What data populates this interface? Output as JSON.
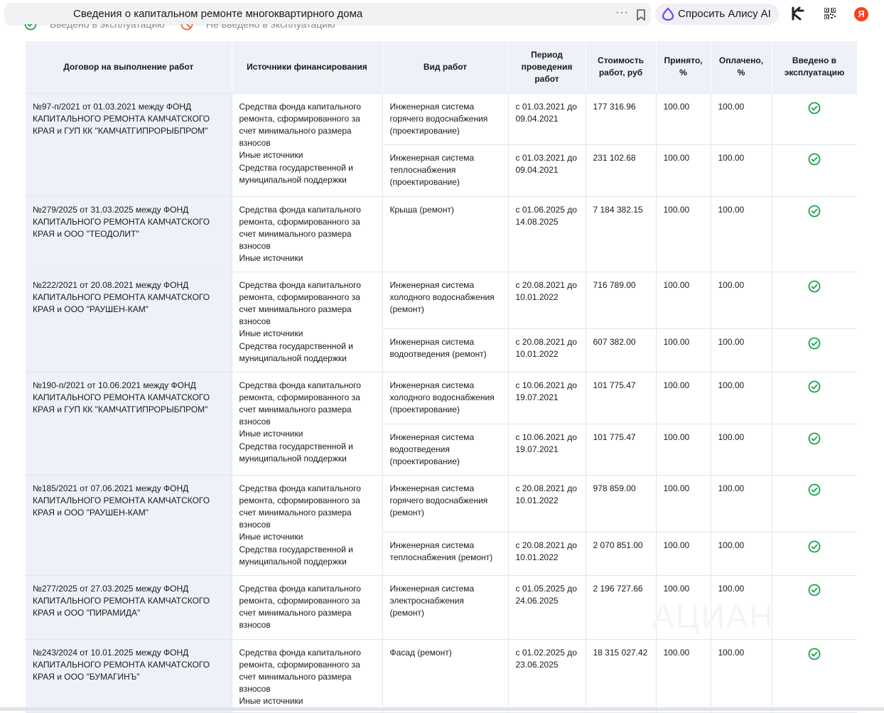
{
  "browser": {
    "page_title": "Сведения о капитальном ремонте многоквартирного дома",
    "menu_dots": "···",
    "alice_label": "Спросить Алису AI",
    "yandex_letter": "Я"
  },
  "legend": {
    "in_operation": "Введено в эксплуатацию",
    "not_in_operation": "Не введено в эксплуатацию"
  },
  "watermark": "АЦИАН",
  "table": {
    "headers": [
      "Договор на выполнение работ",
      "Источники финансирования",
      "Вид работ",
      "Период проведения работ",
      "Стоимость работ, руб",
      "Принято, %",
      "Оплачено, %",
      "Введено в эксплуатацию"
    ],
    "contracts": [
      {
        "contract": "№97-п/2021 от 01.03.2021 между ФОНД КАПИТАЛЬНОГО РЕМОНТА КАМЧАТСКОГО КРАЯ и ГУП КК \"КАМЧАТГИПРОРЫБПРОМ\"",
        "sources": [
          "Средства фонда капитального ремонта, сформированного за счет минимального размера взносов",
          "Иные источники",
          "Средства государственной и муниципальной поддержки"
        ],
        "works": [
          {
            "type": "Инженерная система горячего водоснабжения (проектирование)",
            "period": "с 01.03.2021 до 09.04.2021",
            "cost": "177 316.96",
            "accepted": "100.00",
            "paid": "100.00",
            "in_operation": true
          },
          {
            "type": "Инженерная система теплоснабжения (проектирование)",
            "period": "с 01.03.2021 до 09.04.2021",
            "cost": "231 102.68",
            "accepted": "100.00",
            "paid": "100.00",
            "in_operation": true
          }
        ]
      },
      {
        "contract": "№279/2025 от 31.03.2025 между ФОНД КАПИТАЛЬНОГО РЕМОНТА КАМЧАТСКОГО КРАЯ и ООО \"ТЕОДОЛИТ\"",
        "sources": [
          "Средства фонда капитального ремонта, сформированного за счет минимального размера взносов",
          "Иные источники"
        ],
        "works": [
          {
            "type": "Крыша (ремонт)",
            "period": "с 01.06.2025 до 14.08.2025",
            "cost": "7 184 382.15",
            "accepted": "100.00",
            "paid": "100.00",
            "in_operation": true
          }
        ]
      },
      {
        "contract": "№222/2021 от 20.08.2021 между ФОНД КАПИТАЛЬНОГО РЕМОНТА КАМЧАТСКОГО КРАЯ и ООО \"РАУШЕН-КАМ\"",
        "sources": [
          "Средства фонда капитального ремонта, сформированного за счет минимального размера взносов",
          "Иные источники",
          "Средства государственной и муниципальной поддержки"
        ],
        "works": [
          {
            "type": "Инженерная система холодного водоснабжения (ремонт)",
            "period": "с 20.08.2021 до 10.01.2022",
            "cost": "716 789.00",
            "accepted": "100.00",
            "paid": "100.00",
            "in_operation": true
          },
          {
            "type": "Инженерная система водоотведения (ремонт)",
            "period": "с 20.08.2021 до 10.01.2022",
            "cost": "607 382.00",
            "accepted": "100.00",
            "paid": "100.00",
            "in_operation": true
          }
        ]
      },
      {
        "contract": "№190-п/2021 от 10.06.2021 между ФОНД КАПИТАЛЬНОГО РЕМОНТА КАМЧАТСКОГО КРАЯ и ГУП КК \"КАМЧАТГИПРОРЫБПРОМ\"",
        "sources": [
          "Средства фонда капитального ремонта, сформированного за счет минимального размера взносов",
          "Иные источники",
          "Средства государственной и муниципальной поддержки"
        ],
        "works": [
          {
            "type": "Инженерная система холодного водоснабжения (проектирование)",
            "period": "с 10.06.2021 до 19.07.2021",
            "cost": "101 775.47",
            "accepted": "100.00",
            "paid": "100.00",
            "in_operation": true
          },
          {
            "type": "Инженерная система водоотведения (проектирование)",
            "period": "с 10.06.2021 до 19.07.2021",
            "cost": "101 775.47",
            "accepted": "100.00",
            "paid": "100.00",
            "in_operation": true
          }
        ]
      },
      {
        "contract": "№185/2021 от 07.06.2021 между ФОНД КАПИТАЛЬНОГО РЕМОНТА КАМЧАТСКОГО КРАЯ и ООО \"РАУШЕН-КАМ\"",
        "sources": [
          "Средства фонда капитального ремонта, сформированного за счет минимального размера взносов",
          "Иные источники",
          "Средства государственной и муниципальной поддержки"
        ],
        "works": [
          {
            "type": "Инженерная система горячего водоснабжения (ремонт)",
            "period": "с 20.08.2021 до 10.01.2022",
            "cost": "978 859.00",
            "accepted": "100.00",
            "paid": "100.00",
            "in_operation": true
          },
          {
            "type": "Инженерная система теплоснабжения (ремонт)",
            "period": "с 20.08.2021 до 10.01.2022",
            "cost": "2 070 851.00",
            "accepted": "100.00",
            "paid": "100.00",
            "in_operation": true
          }
        ]
      },
      {
        "contract": "№277/2025 от 27.03.2025 между ФОНД КАПИТАЛЬНОГО РЕМОНТА КАМЧАТСКОГО КРАЯ и ООО \"ПИРАМИДА\"",
        "sources": [
          "Средства фонда капитального ремонта, сформированного за счет минимального размера взносов"
        ],
        "works": [
          {
            "type": "Инженерная система электроснабжения (ремонт)",
            "period": "с 01.05.2025 до 24.06.2025",
            "cost": "2 196 727.66",
            "accepted": "100.00",
            "paid": "100.00",
            "in_operation": true
          }
        ]
      },
      {
        "contract": "№243/2024 от 10.01.2025 между ФОНД КАПИТАЛЬНОГО РЕМОНТА КАМЧАТСКОГО КРАЯ и ООО \"БУМАГИНЪ\"",
        "sources": [
          "Средства фонда капитального ремонта, сформированного за счет минимального размера взносов",
          "Иные источники"
        ],
        "works": [
          {
            "type": "Фасад (ремонт)",
            "period": "с 01.02.2025 до 23.06.2025",
            "cost": "18 315 027.42",
            "accepted": "100.00",
            "paid": "100.00",
            "in_operation": true
          }
        ]
      }
    ]
  },
  "colors": {
    "ok_green": "#1aa34a",
    "no_orange": "#f0662e",
    "header_bg": "#eef1f7",
    "border": "#e3e6ec",
    "alice_purple": "#7a3df5",
    "yandex_red": "#fc3f1d"
  },
  "icons": {
    "status_ok": "check-circle-icon",
    "status_no": "crossed-circle-icon",
    "bookmark": "bookmark-icon",
    "alice": "alice-ring-icon",
    "qr": "qr-code-icon",
    "k": "k-logo-icon"
  }
}
